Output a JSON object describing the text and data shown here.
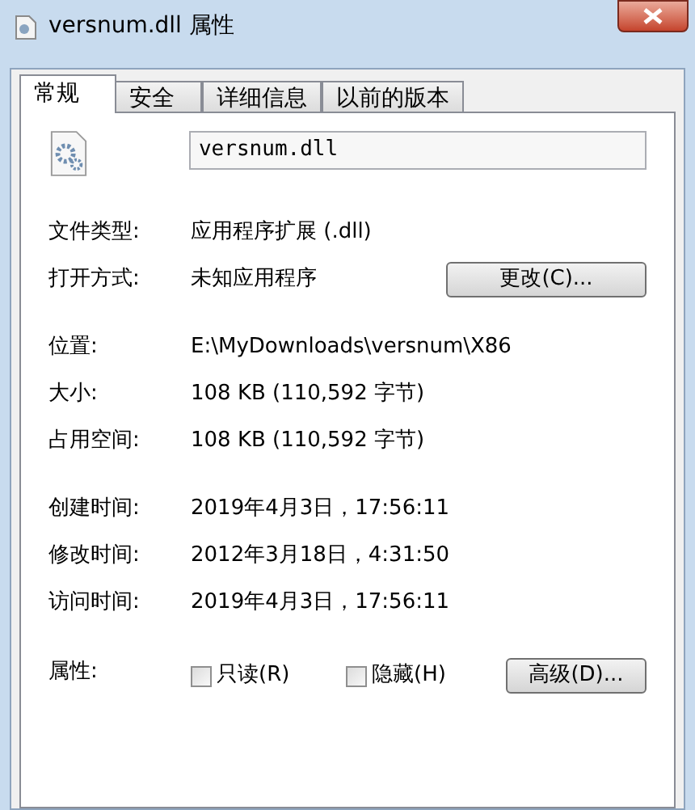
{
  "window": {
    "title": "versnum.dll 属性"
  },
  "tabs": [
    {
      "label": "常规",
      "selected": true
    },
    {
      "label": "安全",
      "selected": false
    },
    {
      "label": "详细信息",
      "selected": false
    },
    {
      "label": "以前的版本",
      "selected": false
    }
  ],
  "file_name": "versnum.dll",
  "groups": [
    [
      {
        "label": "文件类型:",
        "value": "应用程序扩展 (.dll)"
      },
      {
        "label": "打开方式:",
        "value": "未知应用程序",
        "button": "更改(C)..."
      }
    ],
    [
      {
        "label": "位置:",
        "value": "E:\\MyDownloads\\versnum\\X86"
      },
      {
        "label": "大小:",
        "value": "108 KB (110,592 字节)"
      },
      {
        "label": "占用空间:",
        "value": "108 KB (110,592 字节)"
      }
    ],
    [
      {
        "label": "创建时间:",
        "value": "2019年4月3日，17:56:11"
      },
      {
        "label": "修改时间:",
        "value": "2012年3月18日，4:31:50"
      },
      {
        "label": "访问时间:",
        "value": "2019年4月3日，17:56:11"
      }
    ]
  ],
  "attributes": {
    "label": "属性:",
    "checkboxes": [
      {
        "label": "只读(R)",
        "checked": false
      },
      {
        "label": "隐藏(H)",
        "checked": false
      }
    ],
    "button": "高级(D)..."
  }
}
